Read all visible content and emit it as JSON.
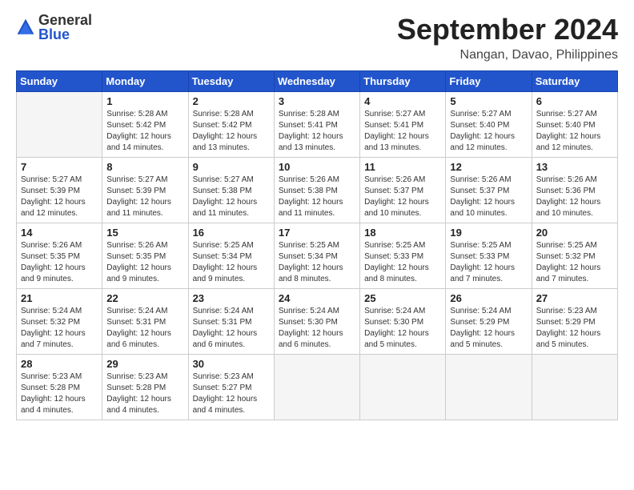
{
  "logo": {
    "general": "General",
    "blue": "Blue"
  },
  "header": {
    "month": "September 2024",
    "location": "Nangan, Davao, Philippines"
  },
  "weekdays": [
    "Sunday",
    "Monday",
    "Tuesday",
    "Wednesday",
    "Thursday",
    "Friday",
    "Saturday"
  ],
  "days": [
    {
      "num": "",
      "empty": true
    },
    {
      "num": "1",
      "sunrise": "5:28 AM",
      "sunset": "5:42 PM",
      "daylight": "12 hours and 14 minutes."
    },
    {
      "num": "2",
      "sunrise": "5:28 AM",
      "sunset": "5:42 PM",
      "daylight": "12 hours and 13 minutes."
    },
    {
      "num": "3",
      "sunrise": "5:28 AM",
      "sunset": "5:41 PM",
      "daylight": "12 hours and 13 minutes."
    },
    {
      "num": "4",
      "sunrise": "5:27 AM",
      "sunset": "5:41 PM",
      "daylight": "12 hours and 13 minutes."
    },
    {
      "num": "5",
      "sunrise": "5:27 AM",
      "sunset": "5:40 PM",
      "daylight": "12 hours and 12 minutes."
    },
    {
      "num": "6",
      "sunrise": "5:27 AM",
      "sunset": "5:40 PM",
      "daylight": "12 hours and 12 minutes."
    },
    {
      "num": "7",
      "sunrise": "5:27 AM",
      "sunset": "5:39 PM",
      "daylight": "12 hours and 12 minutes."
    },
    {
      "num": "8",
      "sunrise": "5:27 AM",
      "sunset": "5:39 PM",
      "daylight": "12 hours and 11 minutes."
    },
    {
      "num": "9",
      "sunrise": "5:27 AM",
      "sunset": "5:38 PM",
      "daylight": "12 hours and 11 minutes."
    },
    {
      "num": "10",
      "sunrise": "5:26 AM",
      "sunset": "5:38 PM",
      "daylight": "12 hours and 11 minutes."
    },
    {
      "num": "11",
      "sunrise": "5:26 AM",
      "sunset": "5:37 PM",
      "daylight": "12 hours and 10 minutes."
    },
    {
      "num": "12",
      "sunrise": "5:26 AM",
      "sunset": "5:37 PM",
      "daylight": "12 hours and 10 minutes."
    },
    {
      "num": "13",
      "sunrise": "5:26 AM",
      "sunset": "5:36 PM",
      "daylight": "12 hours and 10 minutes."
    },
    {
      "num": "14",
      "sunrise": "5:26 AM",
      "sunset": "5:35 PM",
      "daylight": "12 hours and 9 minutes."
    },
    {
      "num": "15",
      "sunrise": "5:26 AM",
      "sunset": "5:35 PM",
      "daylight": "12 hours and 9 minutes."
    },
    {
      "num": "16",
      "sunrise": "5:25 AM",
      "sunset": "5:34 PM",
      "daylight": "12 hours and 9 minutes."
    },
    {
      "num": "17",
      "sunrise": "5:25 AM",
      "sunset": "5:34 PM",
      "daylight": "12 hours and 8 minutes."
    },
    {
      "num": "18",
      "sunrise": "5:25 AM",
      "sunset": "5:33 PM",
      "daylight": "12 hours and 8 minutes."
    },
    {
      "num": "19",
      "sunrise": "5:25 AM",
      "sunset": "5:33 PM",
      "daylight": "12 hours and 7 minutes."
    },
    {
      "num": "20",
      "sunrise": "5:25 AM",
      "sunset": "5:32 PM",
      "daylight": "12 hours and 7 minutes."
    },
    {
      "num": "21",
      "sunrise": "5:24 AM",
      "sunset": "5:32 PM",
      "daylight": "12 hours and 7 minutes."
    },
    {
      "num": "22",
      "sunrise": "5:24 AM",
      "sunset": "5:31 PM",
      "daylight": "12 hours and 6 minutes."
    },
    {
      "num": "23",
      "sunrise": "5:24 AM",
      "sunset": "5:31 PM",
      "daylight": "12 hours and 6 minutes."
    },
    {
      "num": "24",
      "sunrise": "5:24 AM",
      "sunset": "5:30 PM",
      "daylight": "12 hours and 6 minutes."
    },
    {
      "num": "25",
      "sunrise": "5:24 AM",
      "sunset": "5:30 PM",
      "daylight": "12 hours and 5 minutes."
    },
    {
      "num": "26",
      "sunrise": "5:24 AM",
      "sunset": "5:29 PM",
      "daylight": "12 hours and 5 minutes."
    },
    {
      "num": "27",
      "sunrise": "5:23 AM",
      "sunset": "5:29 PM",
      "daylight": "12 hours and 5 minutes."
    },
    {
      "num": "28",
      "sunrise": "5:23 AM",
      "sunset": "5:28 PM",
      "daylight": "12 hours and 4 minutes."
    },
    {
      "num": "29",
      "sunrise": "5:23 AM",
      "sunset": "5:28 PM",
      "daylight": "12 hours and 4 minutes."
    },
    {
      "num": "30",
      "sunrise": "5:23 AM",
      "sunset": "5:27 PM",
      "daylight": "12 hours and 4 minutes."
    },
    {
      "num": "",
      "empty": true
    },
    {
      "num": "",
      "empty": true
    },
    {
      "num": "",
      "empty": true
    },
    {
      "num": "",
      "empty": true
    },
    {
      "num": "",
      "empty": true
    }
  ]
}
